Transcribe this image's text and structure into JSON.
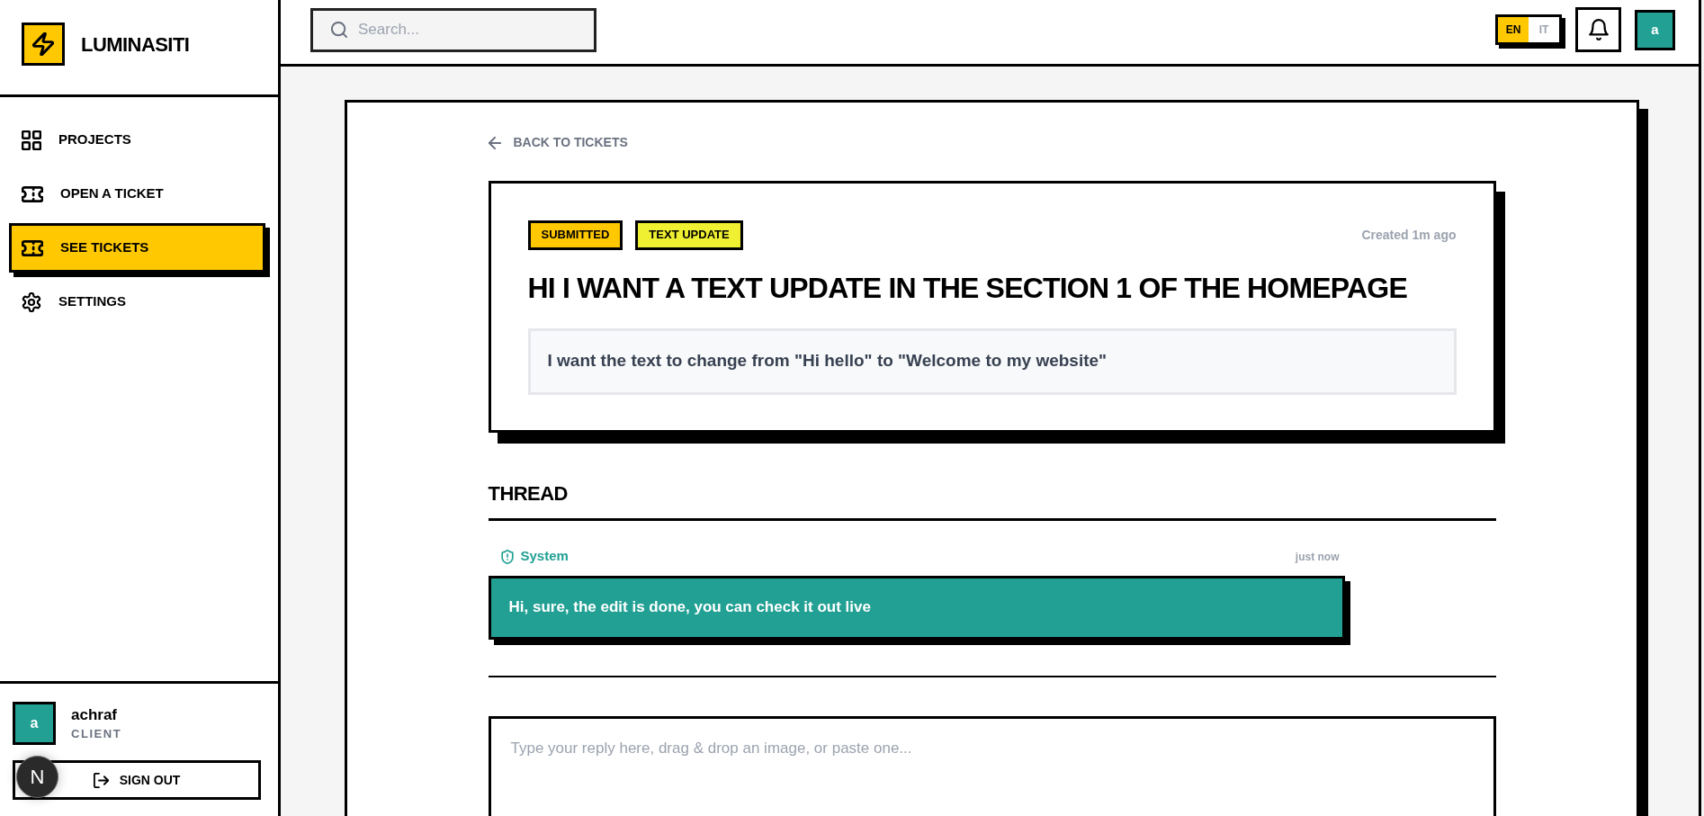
{
  "brand": {
    "name": "LUMINASITI"
  },
  "sidebar": {
    "items": [
      {
        "label": "PROJECTS",
        "kind": "grid",
        "selected": false
      },
      {
        "label": "OPEN A TICKET",
        "kind": "ticket",
        "selected": false
      },
      {
        "label": "SEE TICKETS",
        "kind": "ticket",
        "selected": true
      },
      {
        "label": "SETTINGS",
        "kind": "gear",
        "selected": false
      }
    ]
  },
  "user": {
    "avatar_letter": "a",
    "name": "achraf",
    "role": "CLIENT"
  },
  "sign_out": {
    "label": "SIGN OUT"
  },
  "floating_button": {
    "label": "N"
  },
  "topbar": {
    "search": {
      "placeholder": "Search..."
    },
    "languages": [
      {
        "label": "EN",
        "selected": true
      },
      {
        "label": "IT",
        "selected": false
      }
    ],
    "avatar_letter": "a"
  },
  "back_link": {
    "label": "BACK TO TICKETS"
  },
  "ticket": {
    "tags": [
      {
        "label": "SUBMITTED",
        "color": "#ffc800"
      },
      {
        "label": "TEXT UPDATE",
        "color": "#f0f032"
      }
    ],
    "created": "Created 1m ago",
    "title": "HI I WANT A TEXT UPDATE IN THE SECTION 1 OF THE HOMEPAGE",
    "description": "I want the text to change from \"Hi hello\" to \"Welcome to my website\""
  },
  "thread": {
    "title": "THREAD",
    "messages": [
      {
        "author": "System",
        "time": "just now",
        "text": "Hi, sure, the edit is done, you can check it out live"
      }
    ]
  },
  "reply": {
    "placeholder": "Type your reply here, drag & drop an image, or paste one..."
  }
}
